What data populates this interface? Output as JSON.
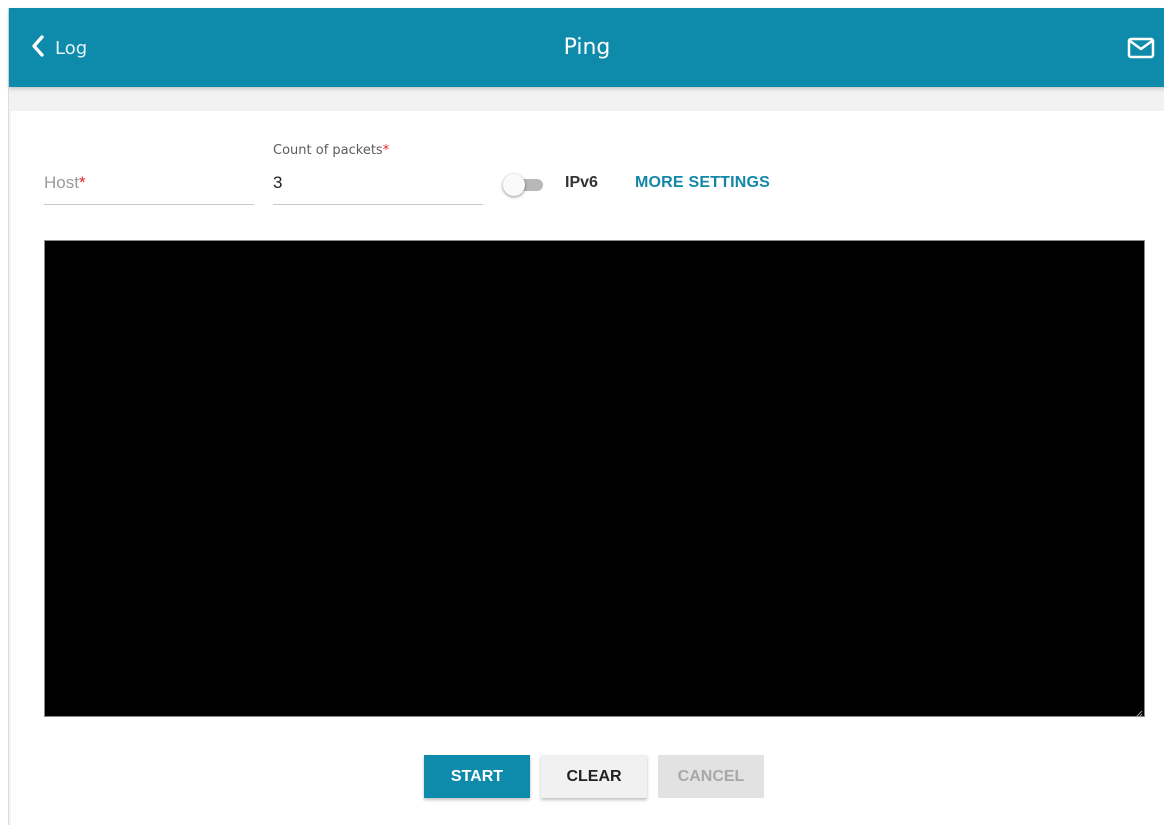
{
  "header": {
    "back_label": "Log",
    "title": "Ping",
    "back_icon": "chevron-left-icon",
    "mail_icon": "mail-icon",
    "color": "#0e8aaa"
  },
  "form": {
    "host": {
      "placeholder": "Host",
      "required_mark": "*",
      "value": ""
    },
    "count": {
      "label": "Count of packets",
      "required_mark": "*",
      "value": "3"
    },
    "ipv6": {
      "label": "IPv6",
      "enabled": false
    },
    "more_settings_label": "MORE SETTINGS"
  },
  "console": {
    "output": ""
  },
  "buttons": {
    "start": "START",
    "clear": "CLEAR",
    "cancel": "CANCEL"
  }
}
